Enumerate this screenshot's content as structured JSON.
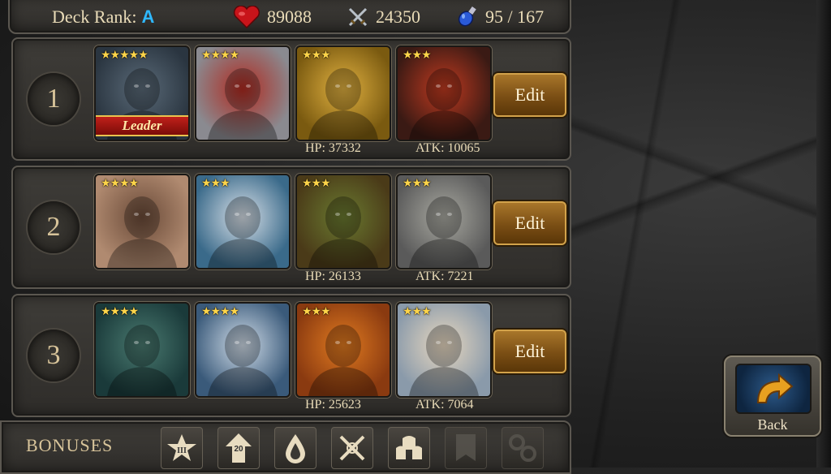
{
  "topbar": {
    "deck_rank_label": "Deck Rank:",
    "deck_rank_value": "A",
    "hp_total": "89088",
    "atk_total": "24350",
    "mana": "95 / 167"
  },
  "decks": [
    {
      "number": "1",
      "cards": [
        {
          "stars": "★★★★★",
          "art": "werewolf",
          "colors": [
            "#2a3540",
            "#5a6a78"
          ],
          "leader": true
        },
        {
          "stars": "★★★★",
          "art": "hooded-assassin",
          "colors": [
            "#8a8a90",
            "#b02a20"
          ]
        },
        {
          "stars": "★★★",
          "art": "golden-paladin",
          "colors": [
            "#7a5a10",
            "#e0b040"
          ]
        },
        {
          "stars": "★★★",
          "art": "red-haired-warrior",
          "colors": [
            "#3a1a14",
            "#c03a20"
          ]
        }
      ],
      "leader_label": "Leader",
      "hp": "HP: 37332",
      "atk": "ATK: 10065",
      "edit_label": "Edit"
    },
    {
      "number": "2",
      "cards": [
        {
          "stars": "★★★★",
          "art": "brunette-woman",
          "colors": [
            "#b08a70",
            "#6a4a38"
          ]
        },
        {
          "stars": "★★★",
          "art": "blue-warrior",
          "colors": [
            "#3a6a8a",
            "#d8e0e8"
          ]
        },
        {
          "stars": "★★★",
          "art": "hooded-goblin",
          "colors": [
            "#4a3a18",
            "#6a7a30"
          ]
        },
        {
          "stars": "★★★",
          "art": "armored-knight",
          "colors": [
            "#5a5a5a",
            "#a8a8a0"
          ]
        }
      ],
      "hp": "HP: 26133",
      "atk": "ATK: 7221",
      "edit_label": "Edit"
    },
    {
      "number": "3",
      "cards": [
        {
          "stars": "★★★★",
          "art": "dark-knight",
          "colors": [
            "#1a3a3a",
            "#4a7a70"
          ]
        },
        {
          "stars": "★★★★",
          "art": "white-beard-mage",
          "colors": [
            "#3a5a7a",
            "#d0dce8"
          ]
        },
        {
          "stars": "★★★",
          "art": "fire-elemental",
          "colors": [
            "#8a3a10",
            "#e07a20"
          ]
        },
        {
          "stars": "★★★",
          "art": "ice-maiden",
          "colors": [
            "#8a9aaa",
            "#e8d8c0"
          ]
        }
      ],
      "hp": "HP: 25623",
      "atk": "ATK: 7064",
      "edit_label": "Edit"
    }
  ],
  "bonuses": {
    "label": "BONUSES",
    "icons": [
      {
        "name": "star-iii-icon",
        "text": "III",
        "active": true
      },
      {
        "name": "arrow-20-icon",
        "text": "20",
        "active": true
      },
      {
        "name": "drop-icon",
        "text": "",
        "active": true
      },
      {
        "name": "crossed-swords-icon",
        "text": "",
        "active": true
      },
      {
        "name": "helmets-icon",
        "text": "",
        "active": true
      },
      {
        "name": "banner-icon",
        "text": "",
        "active": false
      },
      {
        "name": "chain-icon",
        "text": "",
        "active": false
      }
    ]
  },
  "back": {
    "label": "Back"
  }
}
